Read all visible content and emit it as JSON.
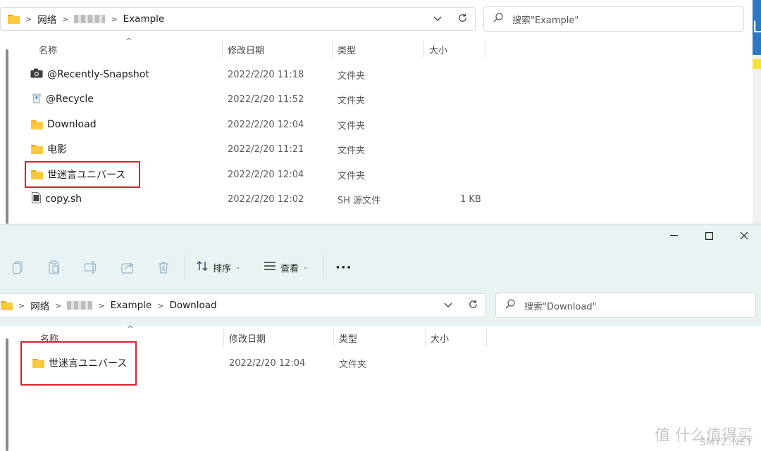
{
  "window_top": {
    "breadcrumb": [
      "网络",
      "Example"
    ],
    "search_placeholder": "搜索\"Example\"",
    "columns": {
      "name": "名称",
      "date": "修改日期",
      "type": "类型",
      "size": "大小"
    },
    "rows": [
      {
        "name": "@Recently-Snapshot",
        "date": "2022/2/20 11:18",
        "type": "文件夹",
        "size": "",
        "icon": "camera-icon"
      },
      {
        "name": "@Recycle",
        "date": "2022/2/20 11:52",
        "type": "文件夹",
        "size": "",
        "icon": "recycle-icon"
      },
      {
        "name": "Download",
        "date": "2022/2/20 12:04",
        "type": "文件夹",
        "size": "",
        "icon": "folder-icon"
      },
      {
        "name": "电影",
        "date": "2022/2/20 11:21",
        "type": "文件夹",
        "size": "",
        "icon": "folder-icon"
      },
      {
        "name": "世迷言ユニバース",
        "date": "2022/2/20 12:04",
        "type": "文件夹",
        "size": "",
        "icon": "folder-icon"
      },
      {
        "name": "copy.sh",
        "date": "2022/2/20 12:02",
        "type": "SH 源文件",
        "size": "1 KB",
        "icon": "script-file-icon"
      }
    ]
  },
  "window_bottom": {
    "toolbar": {
      "sort_label": "排序",
      "view_label": "查看",
      "more_label": "···"
    },
    "breadcrumb": [
      "网络",
      "Example",
      "Download"
    ],
    "search_placeholder": "搜索\"Download\"",
    "columns": {
      "name": "名称",
      "date": "修改日期",
      "type": "类型",
      "size": "大小"
    },
    "rows": [
      {
        "name": "世迷言ユニバース",
        "date": "2022/2/20 12:04",
        "type": "文件夹",
        "size": "",
        "icon": "folder-icon"
      }
    ]
  },
  "side_letter": "L",
  "watermark": {
    "text": "值 什么值得买",
    "site": "SMYZ.NET"
  },
  "colors": {
    "highlight": "#d9232d",
    "toolbar_bg": "#e9f3f4",
    "folder": "#f8c93e"
  }
}
